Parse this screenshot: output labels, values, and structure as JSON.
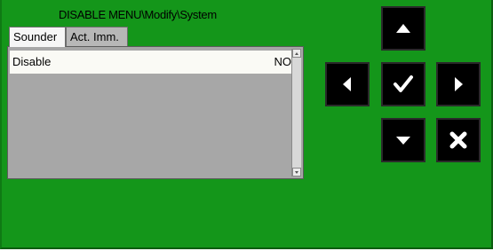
{
  "header": {
    "title": "DISABLE MENU\\Modify\\System"
  },
  "tabs": [
    {
      "label": "Sounder",
      "active": true
    },
    {
      "label": "Act. Imm.",
      "active": false
    }
  ],
  "list": {
    "rows": [
      {
        "label": "Disable",
        "value": "NO"
      }
    ]
  },
  "keypad": {
    "up": "arrow-up-icon",
    "left": "arrow-left-icon",
    "ok": "check-icon",
    "right": "arrow-right-icon",
    "down": "arrow-down-icon",
    "cancel": "cancel-icon"
  },
  "colors": {
    "background": "#14961a",
    "panel": "#a7a7a7",
    "selected_row": "#fafaf5",
    "button": "#000000"
  }
}
